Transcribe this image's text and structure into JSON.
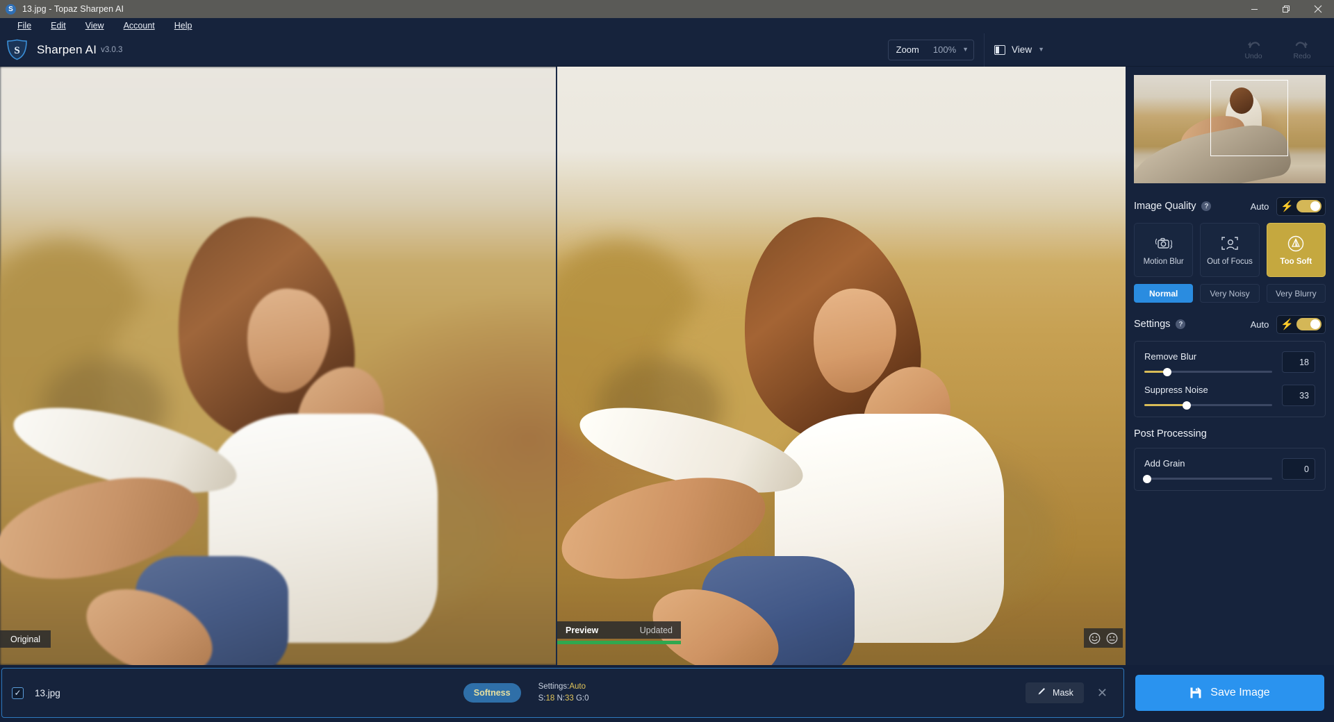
{
  "titlebar": {
    "title": "13.jpg - Topaz Sharpen AI",
    "logo_icon": "sharpen-ai-shield-icon",
    "minimize_icon": "minimize-icon",
    "maximize_icon": "restore-icon",
    "close_icon": "close-icon"
  },
  "menubar": {
    "items": [
      {
        "label": "File",
        "accel": "F"
      },
      {
        "label": "Edit",
        "accel": "E"
      },
      {
        "label": "View",
        "accel": "V"
      },
      {
        "label": "Account",
        "accel": "A"
      },
      {
        "label": "Help",
        "accel": "H"
      }
    ]
  },
  "header": {
    "brand_name": "Sharpen AI",
    "brand_version": "v3.0.3",
    "zoom_label": "Zoom",
    "zoom_value": "100%",
    "zoom_caret": "chevron-down-icon",
    "view_label": "View",
    "view_caret": "chevron-down-icon",
    "view_icon": "split-view-icon",
    "undo_label": "Undo",
    "redo_label": "Redo",
    "undo_icon": "undo-arrow-icon",
    "redo_icon": "redo-arrow-icon"
  },
  "workspace": {
    "original_tag": "Original",
    "preview_tag": "Preview",
    "preview_status": "Updated",
    "progress_color": "#2fa84f",
    "feedback_happy_icon": "smiley-face-icon",
    "feedback_neutral_icon": "neutral-face-icon"
  },
  "sidebar": {
    "navigator": {
      "name": "navigator-thumbnail"
    },
    "image_quality": {
      "title": "Image Quality",
      "help_icon": "help-icon",
      "auto_label": "Auto",
      "auto_enabled": true,
      "bolt_icon": "lightning-bolt-icon",
      "modes": [
        {
          "label": "Motion Blur",
          "icon": "motion-blur-camera-icon",
          "active": false
        },
        {
          "label": "Out of Focus",
          "icon": "out-of-focus-person-icon",
          "active": false
        },
        {
          "label": "Too Soft",
          "icon": "too-soft-prism-icon",
          "active": true
        }
      ],
      "levels": [
        {
          "label": "Normal",
          "active": true
        },
        {
          "label": "Very Noisy",
          "active": false
        },
        {
          "label": "Very Blurry",
          "active": false
        }
      ],
      "active_color": "#c5a83f",
      "level_active_color": "#2a8ce0"
    },
    "settings": {
      "title": "Settings",
      "help_icon": "help-icon",
      "auto_label": "Auto",
      "auto_enabled": true,
      "bolt_icon": "lightning-bolt-icon",
      "sliders": [
        {
          "label": "Remove Blur",
          "value": "18",
          "percent": 18
        },
        {
          "label": "Suppress Noise",
          "value": "33",
          "percent": 33
        }
      ]
    },
    "post_processing": {
      "title": "Post Processing",
      "sliders": [
        {
          "label": "Add Grain",
          "value": "0",
          "percent": 0
        }
      ]
    }
  },
  "bottom_bar": {
    "checkbox_checked": true,
    "check_icon": "checkmark-icon",
    "filename": "13.jpg",
    "pill_label": "Softness",
    "settings_prefix": "Settings:",
    "settings_value": "Auto",
    "sharpen_prefix": "S:",
    "sharpen_value": "18",
    "noise_prefix": "N:",
    "noise_value": "33",
    "grain_prefix": "G:",
    "grain_value": "0",
    "mask_label": "Mask",
    "mask_icon": "brush-icon",
    "close_icon": "close-icon",
    "save_label": "Save Image",
    "save_icon": "floppy-disk-icon",
    "save_color": "#2a93ef"
  }
}
